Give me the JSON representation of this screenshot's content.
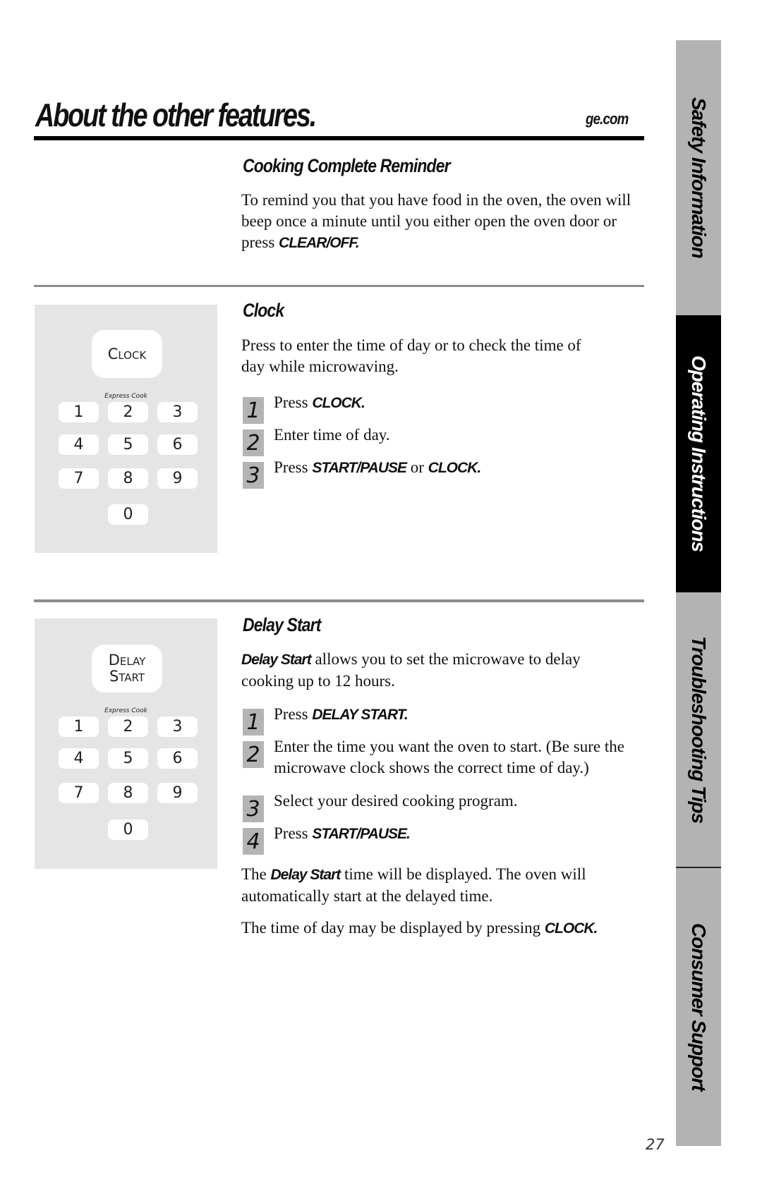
{
  "header": {
    "title": "About the other features.",
    "site": "ge.com"
  },
  "sections": {
    "reminder": {
      "heading": "Cooking Complete Reminder",
      "body_prefix": "To remind you that you have food in the oven, the oven will beep once a minute until you either open the oven door or press ",
      "body_bold": "CLEAR/OFF."
    },
    "clock": {
      "heading": "Clock",
      "body": "Press to enter the time of day or to check the time of day while microwaving.",
      "panel": {
        "key_label": "Clock",
        "express_label": "Express Cook",
        "keys": [
          "1",
          "2",
          "3",
          "4",
          "5",
          "6",
          "7",
          "8",
          "9",
          "0"
        ]
      },
      "steps": [
        {
          "num": "1",
          "prefix": "Press ",
          "bold": "CLOCK.",
          "mid": "",
          "bold2": ""
        },
        {
          "num": "2",
          "prefix": "Enter time of day.",
          "bold": "",
          "mid": "",
          "bold2": ""
        },
        {
          "num": "3",
          "prefix": "Press ",
          "bold": "START/PAUSE",
          "mid": " or ",
          "bold2": "CLOCK."
        }
      ]
    },
    "delay_start": {
      "heading": "Delay Start",
      "intro_bold": "Delay Start",
      "intro_rest": " allows you to set the microwave to delay cooking up to 12 hours.",
      "panel": {
        "key_label_line1": "Delay",
        "key_label_line2": "Start",
        "express_label": "Express Cook",
        "keys": [
          "1",
          "2",
          "3",
          "4",
          "5",
          "6",
          "7",
          "8",
          "9",
          "0"
        ]
      },
      "steps": [
        {
          "num": "1",
          "prefix": "Press ",
          "bold": "DELAY START."
        },
        {
          "num": "2",
          "prefix": "Enter the time you want the oven to start. (Be sure the microwave clock shows the correct time of day.)",
          "bold": ""
        },
        {
          "num": "3",
          "prefix": "Select your desired cooking program.",
          "bold": ""
        },
        {
          "num": "4",
          "prefix": "Press ",
          "bold": "START/PAUSE."
        }
      ],
      "note1_prefix": "The ",
      "note1_bold": "Delay Start",
      "note1_rest": " time will be displayed. The oven will automatically start at the delayed time.",
      "note2_prefix": "The time of day may be displayed by pressing ",
      "note2_bold": "CLOCK."
    }
  },
  "side_tabs": [
    {
      "label": "Safety Information",
      "active": false
    },
    {
      "label": "Operating Instructions",
      "active": true
    },
    {
      "label": "Troubleshooting Tips",
      "active": false
    },
    {
      "label": "Consumer Support",
      "active": false
    }
  ],
  "footer": {
    "page_number": "27"
  }
}
